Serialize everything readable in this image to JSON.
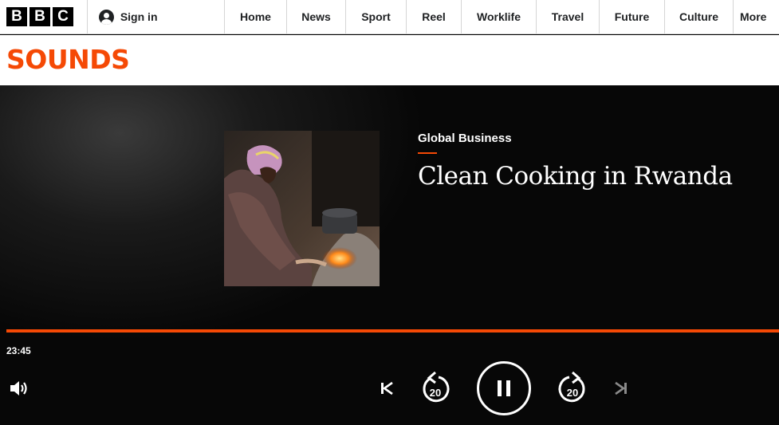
{
  "brand": {
    "bbc_letters": [
      "B",
      "B",
      "C"
    ],
    "signin_label": "Sign in"
  },
  "nav": {
    "items": [
      {
        "label": "Home"
      },
      {
        "label": "News"
      },
      {
        "label": "Sport"
      },
      {
        "label": "Reel"
      },
      {
        "label": "Worklife"
      },
      {
        "label": "Travel"
      },
      {
        "label": "Future"
      },
      {
        "label": "Culture"
      },
      {
        "label": "More"
      }
    ]
  },
  "sounds": {
    "logo_text": "SOUNDS"
  },
  "player": {
    "brand_title": "Global Business",
    "episode_title": "Clean Cooking in Rwanda",
    "elapsed_time": "23:45",
    "progress_fraction": 1.0,
    "rewind_seconds": "20",
    "forward_seconds": "20",
    "state": "playing"
  },
  "colors": {
    "accent": "#f54905",
    "nav_text": "#202224",
    "player_bg": "#0a0a0a"
  },
  "icons": {
    "volume": "volume-icon",
    "previous": "skip-previous-icon",
    "rewind": "rewind-20-icon",
    "pause": "pause-icon",
    "forward": "forward-20-icon",
    "next": "skip-next-icon"
  }
}
